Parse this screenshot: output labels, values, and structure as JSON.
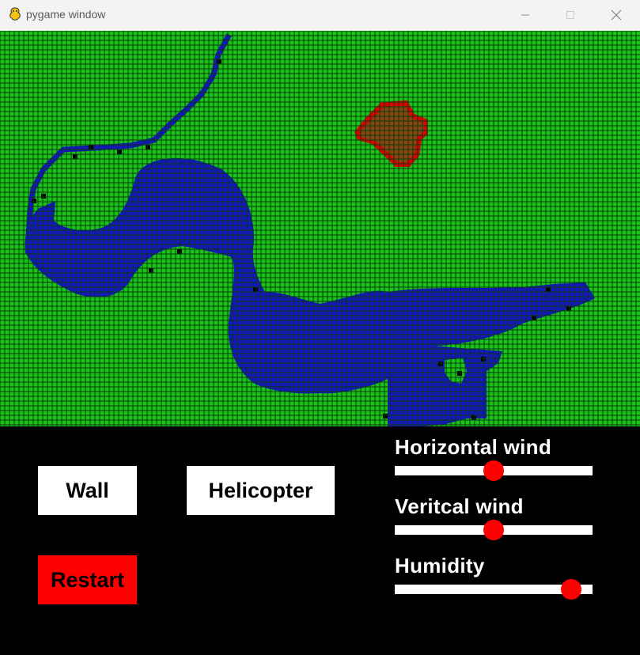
{
  "window": {
    "title": "pygame window",
    "icons": [
      "pygame-snake-icon",
      "minimize-icon",
      "maximize-icon",
      "close-icon"
    ]
  },
  "colors": {
    "grass": "#18c418",
    "grid_line": "#0a3a0a",
    "water": "#1414c8",
    "burnt": "#8b4513",
    "fire": "#e00000",
    "panel_bg": "#000000",
    "button_bg": "#ffffff",
    "restart_bg": "#ff0000",
    "knob": "#ff0000"
  },
  "controls": {
    "wall_label": "Wall",
    "helicopter_label": "Helicopter",
    "restart_label": "Restart"
  },
  "sliders": {
    "horizontal_wind": {
      "label": "Horizontal wind",
      "fraction": 0.5
    },
    "vertical_wind": {
      "label": "Veritcal wind",
      "fraction": 0.5
    },
    "humidity": {
      "label": "Humidity",
      "fraction": 0.89
    }
  }
}
